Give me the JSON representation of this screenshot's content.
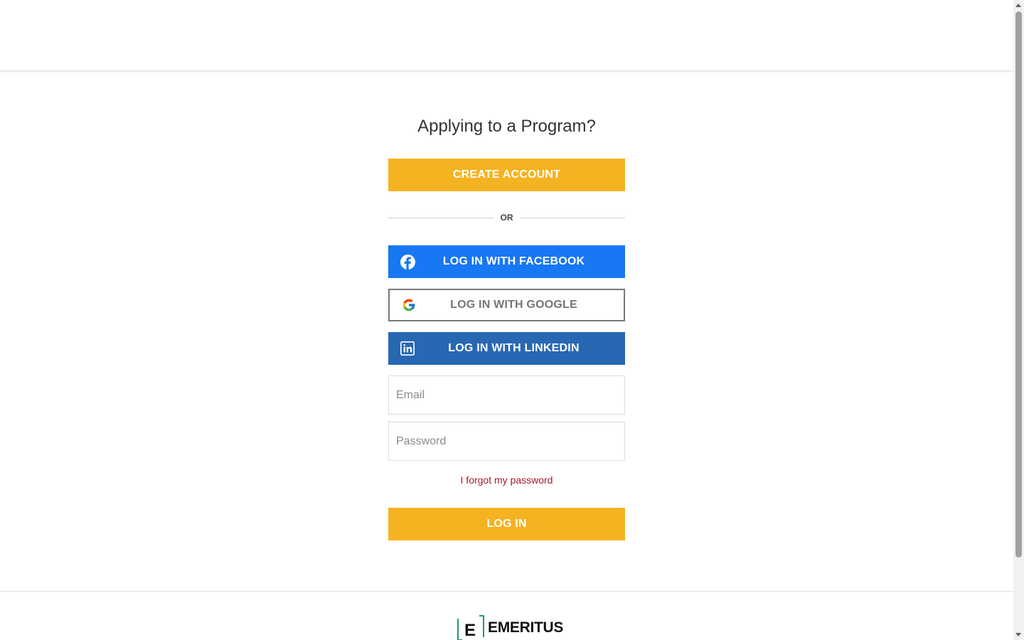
{
  "login": {
    "title": "Applying to a Program?",
    "create_account": "CREATE ACCOUNT",
    "or_text": "OR",
    "facebook": "LOG IN WITH FACEBOOK",
    "google": "LOG IN WITH GOOGLE",
    "linkedin": "LOG IN WITH LINKEDIN",
    "email_placeholder": "Email",
    "password_placeholder": "Password",
    "forgot_password": "I forgot my password",
    "login_button": "LOG IN"
  },
  "footer": {
    "brand_letter": "E",
    "brand_name": "EMERITUS"
  },
  "colors": {
    "primary_yellow": "#f5b322",
    "facebook_blue": "#1877f2",
    "linkedin_blue": "#2867b2",
    "link_red": "#a3192e",
    "brand_green": "#1f9a62"
  },
  "icons": {
    "facebook": "facebook-icon",
    "google": "google-icon",
    "linkedin": "linkedin-icon"
  }
}
